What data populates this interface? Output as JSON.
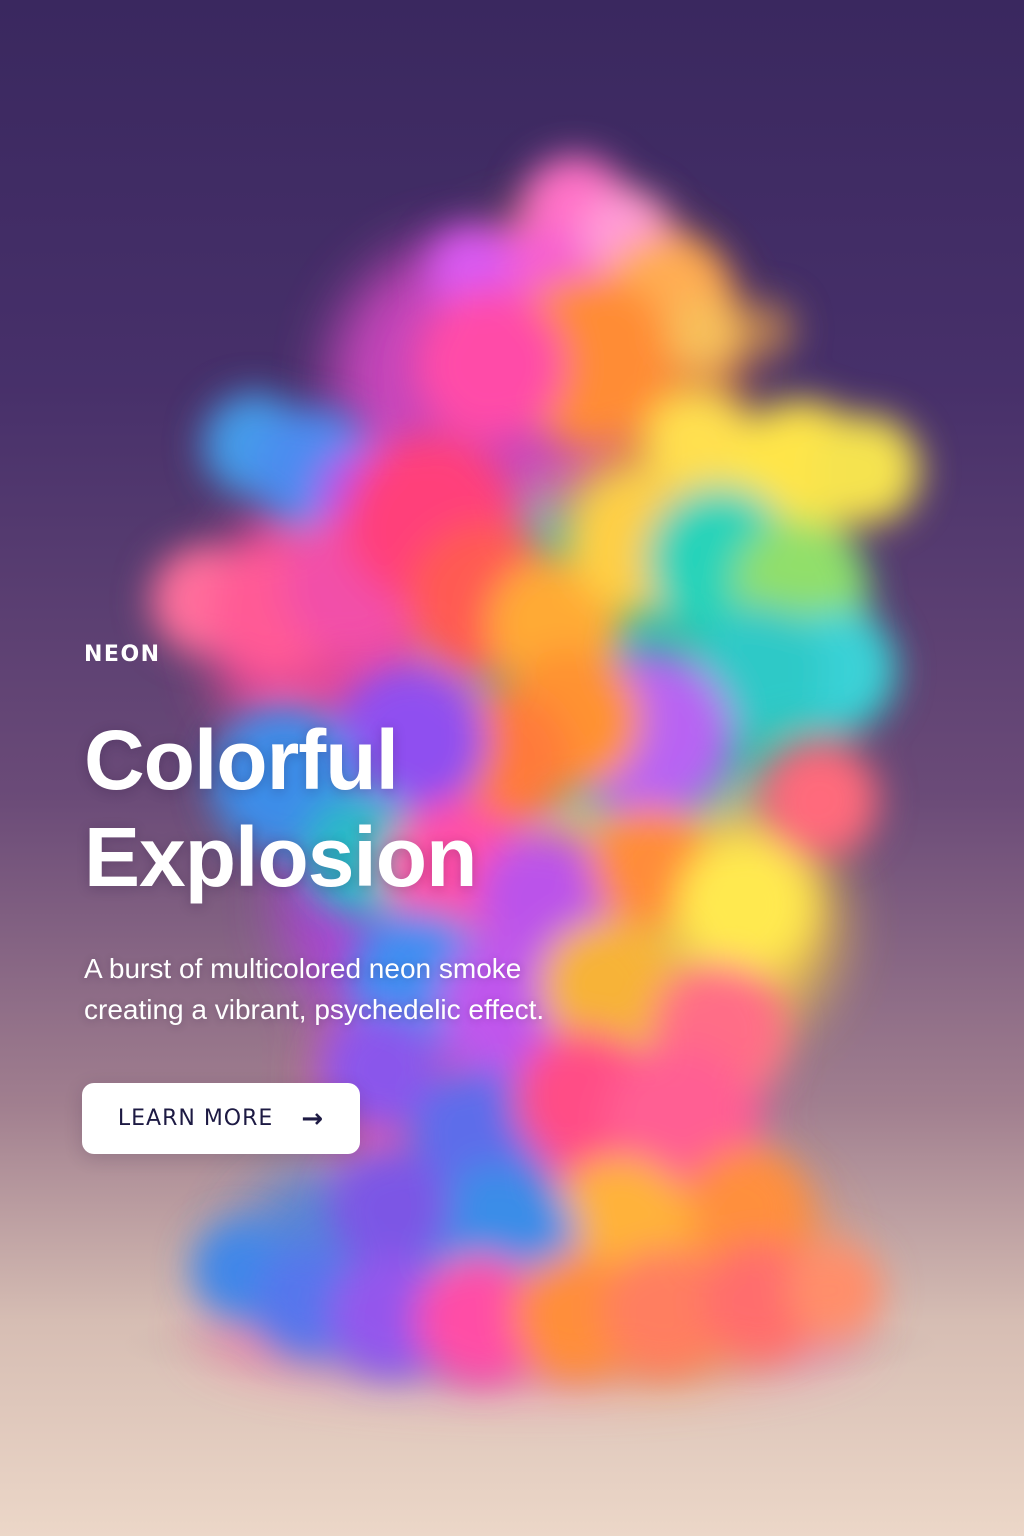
{
  "hero": {
    "eyebrow": "NEON",
    "title_line_1": "Colorful",
    "title_line_2": "Explosion",
    "description_line_1": "A burst of multicolored neon smoke",
    "description_line_2": "creating a vibrant, psychedelic effect.",
    "cta_label": "LEARN MORE",
    "cta_icon": "arrow-right-icon"
  },
  "colors": {
    "background_top": "#3a285f",
    "background_bottom": "#ecd7c8",
    "cta_background": "#ffffff",
    "cta_text": "#1d1a43",
    "smoke_pink": "#ff4fb5",
    "smoke_orange": "#ff9f2e",
    "smoke_yellow": "#ffe84a",
    "smoke_teal": "#28d6b1",
    "smoke_blue": "#3a83e8",
    "smoke_purple": "#8c4ee8"
  }
}
